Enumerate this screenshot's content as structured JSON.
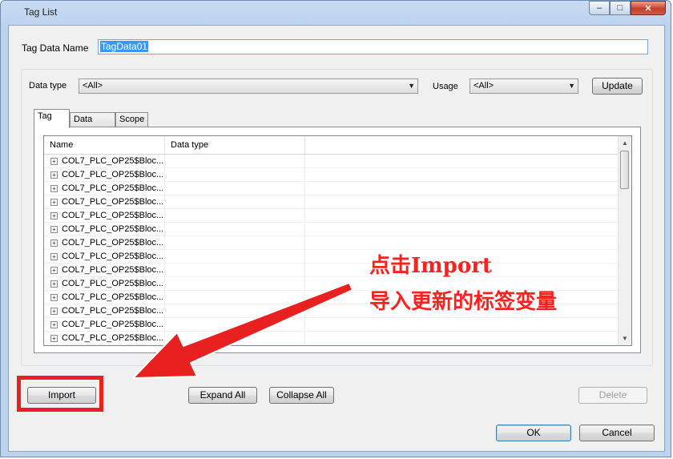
{
  "window": {
    "title": "Tag List",
    "close_glyph": "✕",
    "min_glyph": "–",
    "max_glyph": "□"
  },
  "tag_data_name": {
    "label": "Tag Data Name",
    "value": "TagData01"
  },
  "filters": {
    "data_type_label": "Data type",
    "data_type_value": "<All>",
    "usage_label": "Usage",
    "usage_value": "<All>",
    "update_label": "Update"
  },
  "tabs": [
    {
      "label": "Tag",
      "active": true
    },
    {
      "label": "Data type",
      "active": false
    },
    {
      "label": "Scope",
      "active": false
    }
  ],
  "list": {
    "columns": [
      "Name",
      "Data type"
    ],
    "rows": [
      "COL7_PLC_OP25$Bloc...",
      "COL7_PLC_OP25$Bloc...",
      "COL7_PLC_OP25$Bloc...",
      "COL7_PLC_OP25$Bloc...",
      "COL7_PLC_OP25$Bloc...",
      "COL7_PLC_OP25$Bloc...",
      "COL7_PLC_OP25$Bloc...",
      "COL7_PLC_OP25$Bloc...",
      "COL7_PLC_OP25$Bloc...",
      "COL7_PLC_OP25$Bloc...",
      "COL7_PLC_OP25$Bloc...",
      "COL7_PLC_OP25$Bloc...",
      "COL7_PLC_OP25$Bloc...",
      "COL7_PLC_OP25$Bloc..."
    ]
  },
  "buttons": {
    "import": "Import",
    "expand_all": "Expand All",
    "collapse_all": "Collapse All",
    "delete": "Delete",
    "ok": "OK",
    "cancel": "Cancel"
  },
  "annotation": {
    "line1": "点击Import",
    "line2": "导入更新的标签变量",
    "color": "#ff2020"
  }
}
